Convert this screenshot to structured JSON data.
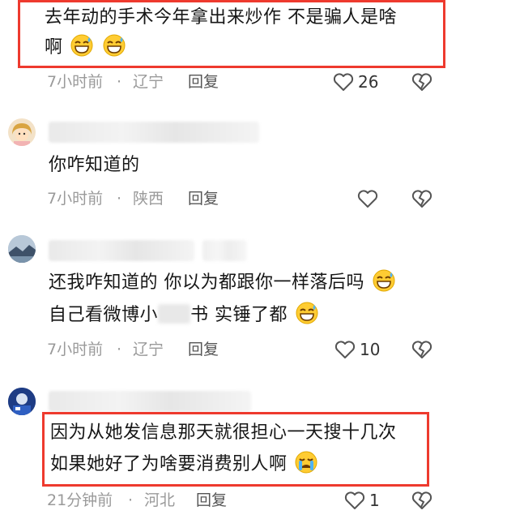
{
  "comments": [
    {
      "lines": [
        "去年动的手术今年拿出来炒作 不是骗人是啥",
        "啊"
      ],
      "time": "7小时前",
      "sep": "·",
      "location": "辽宁",
      "reply": "回复",
      "likes": "26",
      "avatar": "none"
    },
    {
      "lines": [
        "你咋知道的"
      ],
      "time": "7小时前",
      "sep": "·",
      "location": "陕西",
      "reply": "回复",
      "likes": "",
      "avatar": "girl-avatar"
    },
    {
      "lines": [
        "还我咋知道的 你以为都跟你一样落后吗",
        "自己看微博小",
        "书 实锤了都"
      ],
      "time": "7小时前",
      "sep": "·",
      "location": "辽宁",
      "reply": "回复",
      "likes": "10",
      "avatar": "scenery-avatar"
    },
    {
      "lines": [
        "因为从她发信息那天就很担心一天搜十几次",
        "如果她好了为啥要消费别人啊"
      ],
      "time": "21分钟前",
      "sep": "·",
      "location": "河北",
      "reply": "回复",
      "likes": "1",
      "avatar": "blue-avatar"
    }
  ],
  "colors": {
    "highlight": "#ee3a2e",
    "meta": "#9a9a9a"
  }
}
